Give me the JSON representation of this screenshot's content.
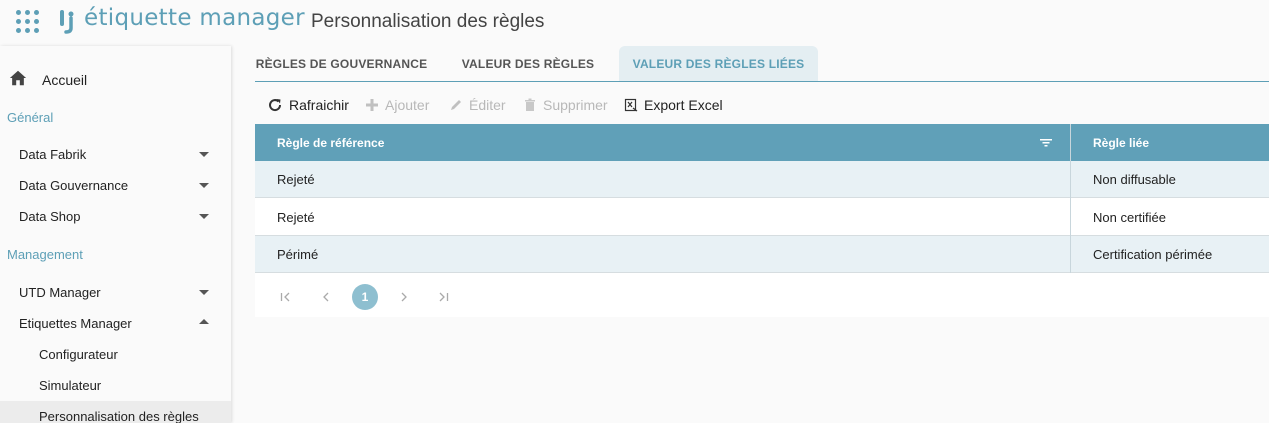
{
  "header": {
    "brand": "étiquette manager",
    "title": "Personnalisation des règles"
  },
  "sidebar": {
    "home_label": "Accueil",
    "section_general": "Général",
    "general_items": [
      {
        "label": "Data Fabrik",
        "expanded": false
      },
      {
        "label": "Data Gouvernance",
        "expanded": false
      },
      {
        "label": "Data Shop",
        "expanded": false
      }
    ],
    "section_management": "Management",
    "management_items": [
      {
        "label": "UTD Manager",
        "expanded": false
      },
      {
        "label": "Etiquettes Manager",
        "expanded": true
      }
    ],
    "sub_items": [
      {
        "label": "Configurateur"
      },
      {
        "label": "Simulateur"
      },
      {
        "label": "Personnalisation des règles",
        "active": true
      }
    ]
  },
  "tabs": [
    {
      "label": "RÈGLES DE GOUVERNANCE",
      "active": false
    },
    {
      "label": "VALEUR DES RÈGLES",
      "active": false
    },
    {
      "label": "VALEUR DES RÈGLES LIÉES",
      "active": true
    }
  ],
  "toolbar": {
    "refresh": "Rafraichir",
    "add": "Ajouter",
    "edit": "Éditer",
    "delete": "Supprimer",
    "export": "Export Excel"
  },
  "grid": {
    "columns": [
      "Règle de référence",
      "Règle liée"
    ],
    "rows": [
      [
        "Rejeté",
        "Non diffusable"
      ],
      [
        "Rejeté",
        "Non certifiée"
      ],
      [
        "Périmé",
        "Certification périmée"
      ]
    ]
  },
  "pager": {
    "current_page": "1"
  },
  "colors": {
    "accent": "#5d9fb6",
    "grid_header": "#60a0b8",
    "row_alt": "#e8f1f5"
  }
}
